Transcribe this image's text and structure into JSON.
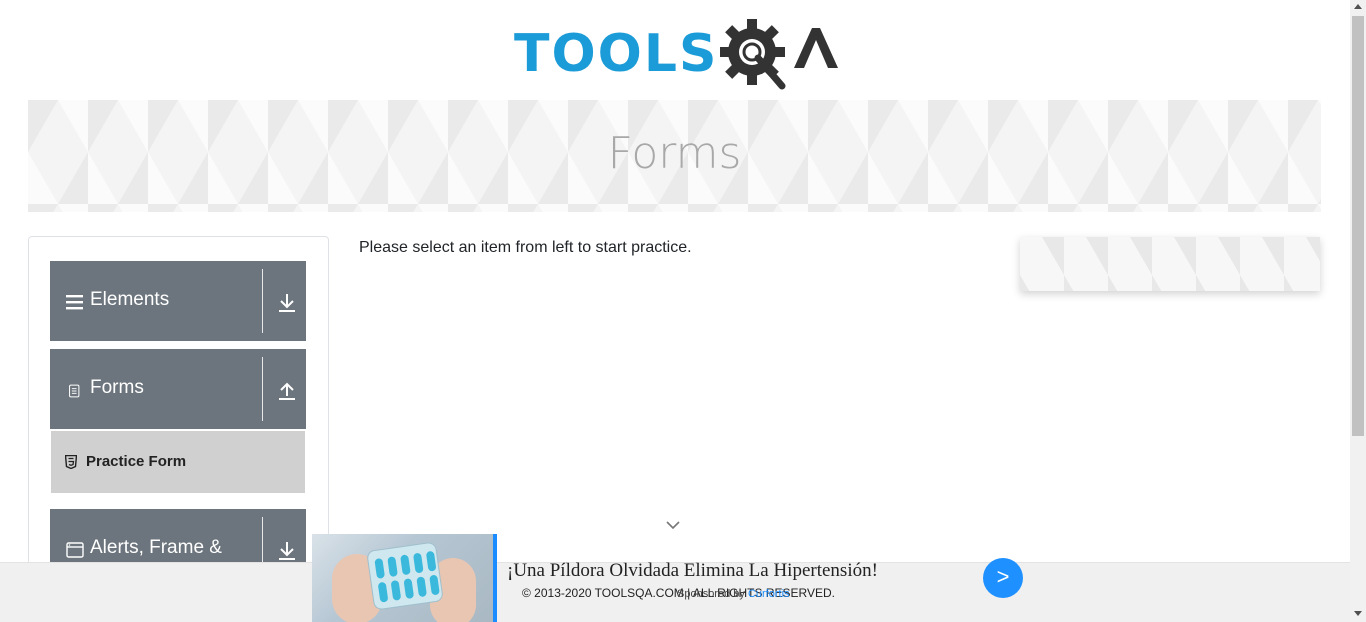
{
  "header": {
    "logo_text": "TOOLS",
    "logo_suffix": "QA",
    "logo_icon": "gear-magnifier-icon"
  },
  "banner": {
    "title": "Forms"
  },
  "sidebar": {
    "groups": [
      {
        "label": "Elements",
        "icon": "hamburger-icon",
        "arrow": "download-arrow-icon"
      },
      {
        "label": "Forms",
        "icon": "document-icon",
        "arrow": "upload-arrow-icon"
      },
      {
        "label": "Alerts, Frame &",
        "icon": "window-icon",
        "arrow": "download-arrow-icon"
      }
    ],
    "items": [
      {
        "label": "Practice Form",
        "icon": "html5-icon"
      }
    ]
  },
  "main": {
    "message": "Please select an item from left to start practice."
  },
  "footer": {
    "copyright": "© 2013-2020 TOOLSQA.COM | ALL RIGHTS RESERVED."
  },
  "ad": {
    "headline": "¡Una Píldora Olvidada Elimina La Hipertensión!",
    "sponsored_label": "Sponsored by",
    "sponsor": "Curfortis",
    "go_label": ">"
  },
  "colors": {
    "brand_blue": "#1b9bd7",
    "brand_dark": "#333333",
    "group_bg": "#6c757d",
    "selected_item_bg": "#d0d0d0",
    "ad_accent": "#1a8cff"
  }
}
